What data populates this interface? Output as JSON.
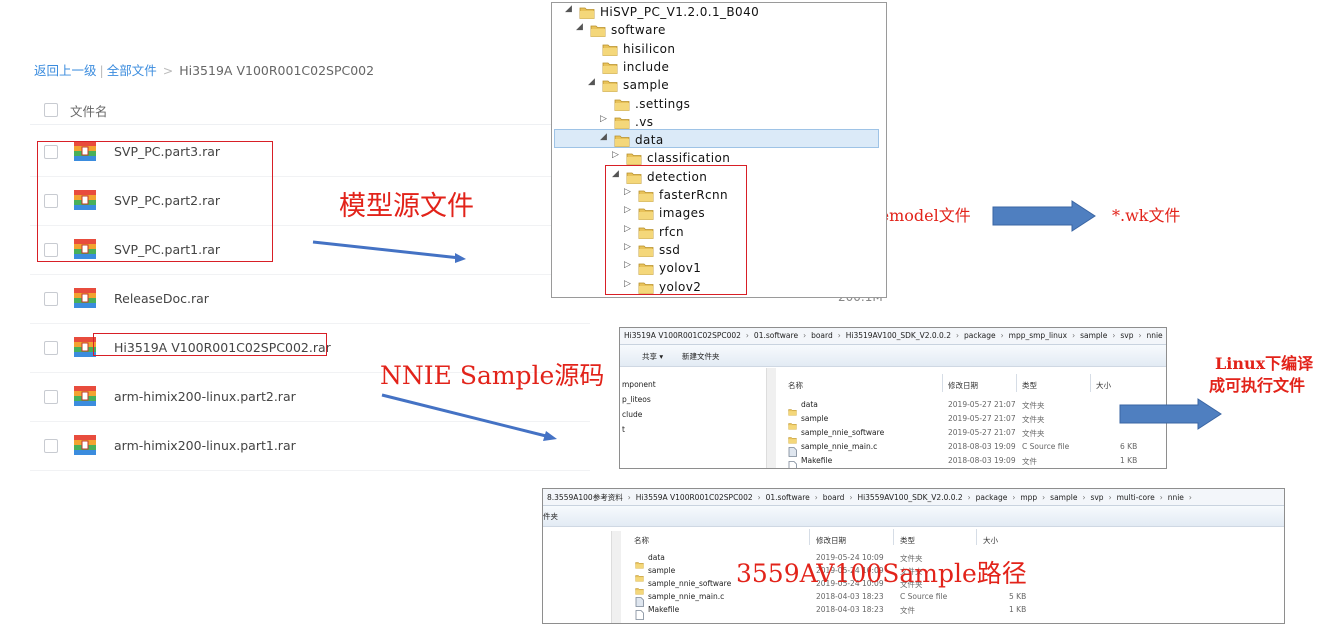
{
  "file_list": {
    "breadcrumb": {
      "back": "返回上一级",
      "sep": "|",
      "all": "全部文件",
      "arrow": ">",
      "current": "Hi3519A V100R001C02SPC002"
    },
    "header_label": "文件名",
    "files": [
      {
        "name": "SVP_PC.part3.rar"
      },
      {
        "name": "SVP_PC.part2.rar"
      },
      {
        "name": "SVP_PC.part1.rar"
      },
      {
        "name": "ReleaseDoc.rar"
      },
      {
        "name": "Hi3519A V100R001C02SPC002.rar"
      },
      {
        "name": "arm-himix200-linux.part2.rar"
      },
      {
        "name": "arm-himix200-linux.part1.rar"
      }
    ],
    "partial_size": "200.1M"
  },
  "annotations": {
    "model_source": "模型源文件",
    "nnie_sample": "NNIE Sample源码",
    "proto_caffe": "*.prototxt,*.caffemodel文件",
    "wk": "*.wk文件",
    "linux_compile_1": "Linux下编译",
    "linux_compile_2": "成可执行文件",
    "path_3559": "3559AV100Sample路径"
  },
  "tree": {
    "items": [
      {
        "label": "HiSVP_PC_V1.2.0.1_B040",
        "arrow": "◢"
      },
      {
        "label": "software",
        "arrow": "◢"
      },
      {
        "label": "hisilicon",
        "arrow": ""
      },
      {
        "label": "include",
        "arrow": ""
      },
      {
        "label": "sample",
        "arrow": "◢"
      },
      {
        "label": ".settings",
        "arrow": ""
      },
      {
        "label": ".vs",
        "arrow": "▷"
      },
      {
        "label": "data",
        "arrow": "◢"
      },
      {
        "label": "classification",
        "arrow": "▷"
      },
      {
        "label": "detection",
        "arrow": "◢"
      },
      {
        "label": "fasterRcnn",
        "arrow": "▷"
      },
      {
        "label": "images",
        "arrow": "▷"
      },
      {
        "label": "rfcn",
        "arrow": "▷"
      },
      {
        "label": "ssd",
        "arrow": "▷"
      },
      {
        "label": "yolov1",
        "arrow": "▷"
      },
      {
        "label": "yolov2",
        "arrow": "▷"
      }
    ]
  },
  "explorer1": {
    "address": [
      "Hi3519A V100R001C02SPC002",
      "01.software",
      "board",
      "Hi3519AV100_SDK_V2.0.0.2",
      "package",
      "mpp_smp_linux",
      "sample",
      "svp",
      "nnie"
    ],
    "toolbar": {
      "share": "共享 ▾",
      "new_folder": "新建文件夹"
    },
    "nav": [
      "mponent",
      "p_liteos",
      "clude",
      "t"
    ],
    "columns": {
      "name": "名称",
      "date": "修改日期",
      "type": "类型",
      "size": "大小"
    },
    "rows": [
      {
        "name": "data",
        "date": "2019-05-27 21:07",
        "type": "文件夹",
        "size": "",
        "icon": "folder"
      },
      {
        "name": "sample",
        "date": "2019-05-27 21:07",
        "type": "文件夹",
        "size": "",
        "icon": "folder"
      },
      {
        "name": "sample_nnie_software",
        "date": "2019-05-27 21:07",
        "type": "文件夹",
        "size": "",
        "icon": "folder"
      },
      {
        "name": "sample_nnie_main.c",
        "date": "2018-08-03 19:09",
        "type": "C Source file",
        "size": "6 KB",
        "icon": "c-file"
      },
      {
        "name": "Makefile",
        "date": "2018-08-03 19:09",
        "type": "文件",
        "size": "1 KB",
        "icon": "file"
      }
    ]
  },
  "explorer2": {
    "address": [
      "8.3559A100参考资料",
      "Hi3559A V100R001C02SPC002",
      "01.software",
      "board",
      "Hi3559AV100_SDK_V2.0.0.2",
      "package",
      "mpp",
      "sample",
      "svp",
      "multi-core",
      "nnie"
    ],
    "toolbar_frag": "件夹",
    "columns": {
      "name": "名称",
      "date": "修改日期",
      "type": "类型",
      "size": "大小"
    },
    "rows": [
      {
        "name": "data",
        "date": "2019-05-24 10:09",
        "type": "文件夹",
        "size": "",
        "icon": "folder"
      },
      {
        "name": "sample",
        "date": "2019-05-24 10:09",
        "type": "文件夹",
        "size": "",
        "icon": "folder"
      },
      {
        "name": "sample_nnie_software",
        "date": "2019-05-24 10:09",
        "type": "文件夹",
        "size": "",
        "icon": "folder"
      },
      {
        "name": "sample_nnie_main.c",
        "date": "2018-04-03 18:23",
        "type": "C Source file",
        "size": "5 KB",
        "icon": "c-file"
      },
      {
        "name": "Makefile",
        "date": "2018-04-03 18:23",
        "type": "文件",
        "size": "1 KB",
        "icon": "file"
      }
    ]
  },
  "colors": {
    "link": "#3b8cde",
    "annotation_red": "#e2231a",
    "arrow_blue": "#4472c4",
    "folder": "#e8c25a"
  }
}
